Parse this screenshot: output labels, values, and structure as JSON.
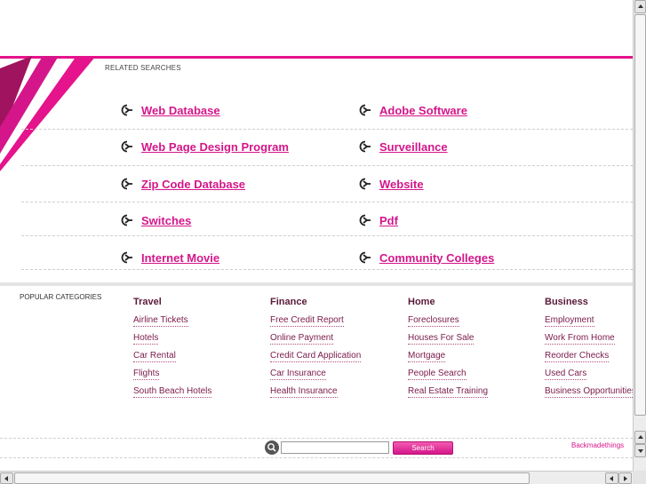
{
  "related": {
    "title": "RELATED SEARCHES",
    "links": [
      "Web Database",
      "Adobe Software",
      "Web Page Design Program",
      "Surveillance",
      "Zip Code Database",
      "Website",
      "Switches",
      "Pdf",
      "Internet Movie",
      "Community Colleges"
    ]
  },
  "popular": {
    "title": "POPULAR CATEGORIES",
    "categories": [
      {
        "name": "Travel",
        "items": [
          "Airline Tickets",
          "Hotels",
          "Car Rental",
          "Flights",
          "South Beach Hotels"
        ]
      },
      {
        "name": "Finance",
        "items": [
          "Free Credit Report",
          "Online Payment",
          "Credit Card Application",
          "Car Insurance",
          "Health Insurance"
        ]
      },
      {
        "name": "Home",
        "items": [
          "Foreclosures",
          "Houses For Sale",
          "Mortgage",
          "People Search",
          "Real Estate Training"
        ]
      },
      {
        "name": "Business",
        "items": [
          "Employment",
          "Work From Home",
          "Reorder Checks",
          "Used Cars",
          "Business Opportunities"
        ]
      }
    ]
  },
  "search": {
    "placeholder": "",
    "button_label": "Search"
  },
  "footer": {
    "backlink": "Backmadethings"
  },
  "colors": {
    "accent": "#e5138c",
    "link": "#d4168a",
    "category_heading": "#5a1a3a"
  },
  "icons": {
    "link_bullet": "arrow-right-circle-icon",
    "search": "magnifier-icon"
  }
}
